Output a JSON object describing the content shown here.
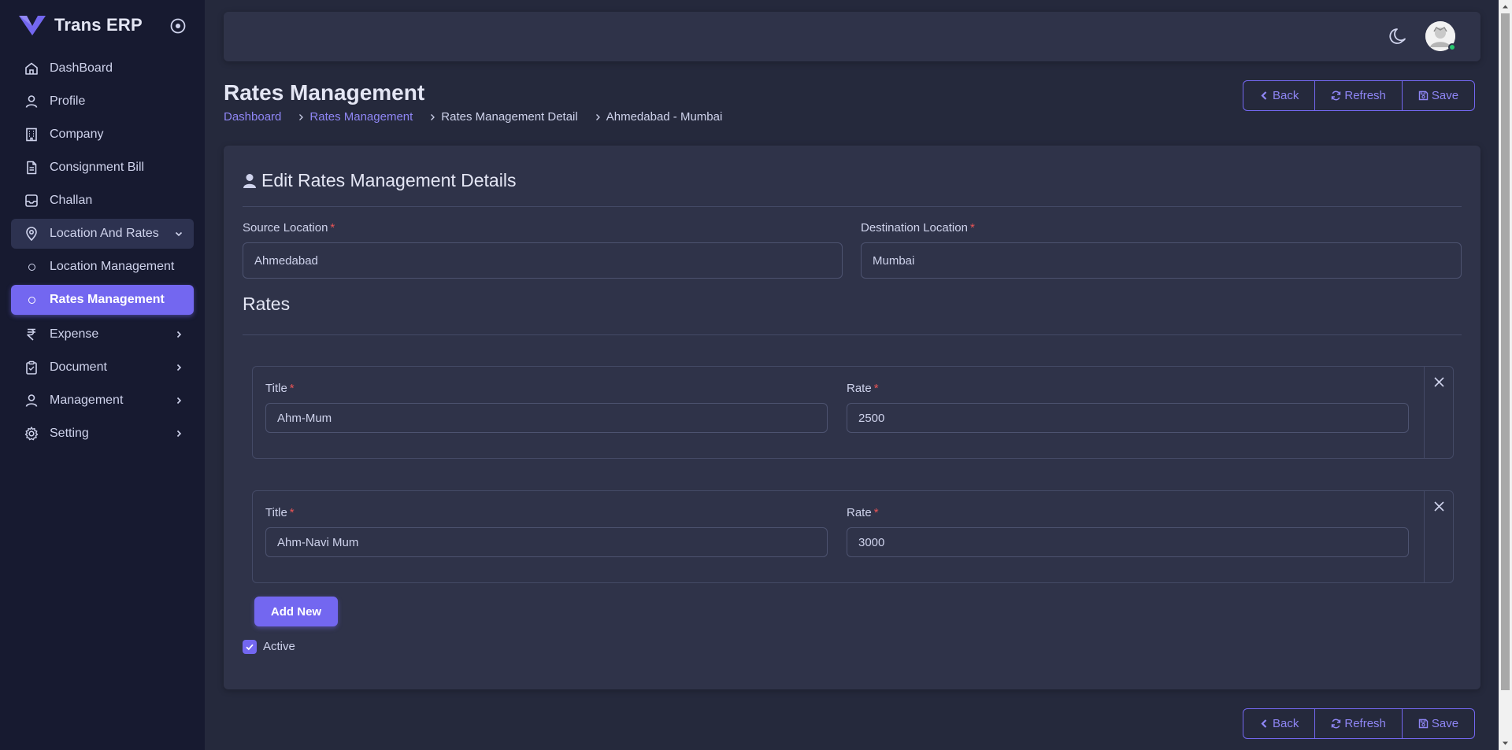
{
  "app": {
    "name": "Trans ERP"
  },
  "sidebar": {
    "items": [
      {
        "label": "DashBoard",
        "icon": "home-icon"
      },
      {
        "label": "Profile",
        "icon": "user-icon"
      },
      {
        "label": "Company",
        "icon": "building-icon"
      },
      {
        "label": "Consignment Bill",
        "icon": "file-icon"
      },
      {
        "label": "Challan",
        "icon": "inbox-icon"
      },
      {
        "label": "Location And Rates",
        "icon": "map-pin-icon"
      },
      {
        "label": "Location Management"
      },
      {
        "label": "Rates Management"
      },
      {
        "label": "Expense",
        "icon": "rupee-icon"
      },
      {
        "label": "Document",
        "icon": "clipboard-icon"
      },
      {
        "label": "Management",
        "icon": "user-icon"
      },
      {
        "label": "Setting",
        "icon": "gear-icon"
      }
    ]
  },
  "page": {
    "title": "Rates Management",
    "breadcrumb": [
      "Dashboard",
      "Rates Management",
      "Rates Management Detail",
      "Ahmedabad - Mumbai"
    ]
  },
  "actions": {
    "back": "Back",
    "refresh": "Refresh",
    "save": "Save"
  },
  "form": {
    "heading": "Edit Rates Management Details",
    "source_label": "Source Location",
    "source_value": "Ahmedabad",
    "destination_label": "Destination Location",
    "destination_value": "Mumbai",
    "required_mark": "*",
    "rates_heading": "Rates",
    "rates": [
      {
        "title_label": "Title",
        "title_value": "Ahm-Mum",
        "rate_label": "Rate",
        "rate_value": "2500"
      },
      {
        "title_label": "Title",
        "title_value": "Ahm-Navi Mum",
        "rate_label": "Rate",
        "rate_value": "3000"
      }
    ],
    "add_new": "Add New",
    "active_label": "Active",
    "active_checked": true
  },
  "colors": {
    "accent": "#7367f0",
    "sidebar_bg": "#171a30",
    "card_bg": "#2f3349",
    "page_bg": "#25293c",
    "required": "#ea5455",
    "online": "#28c76f"
  }
}
